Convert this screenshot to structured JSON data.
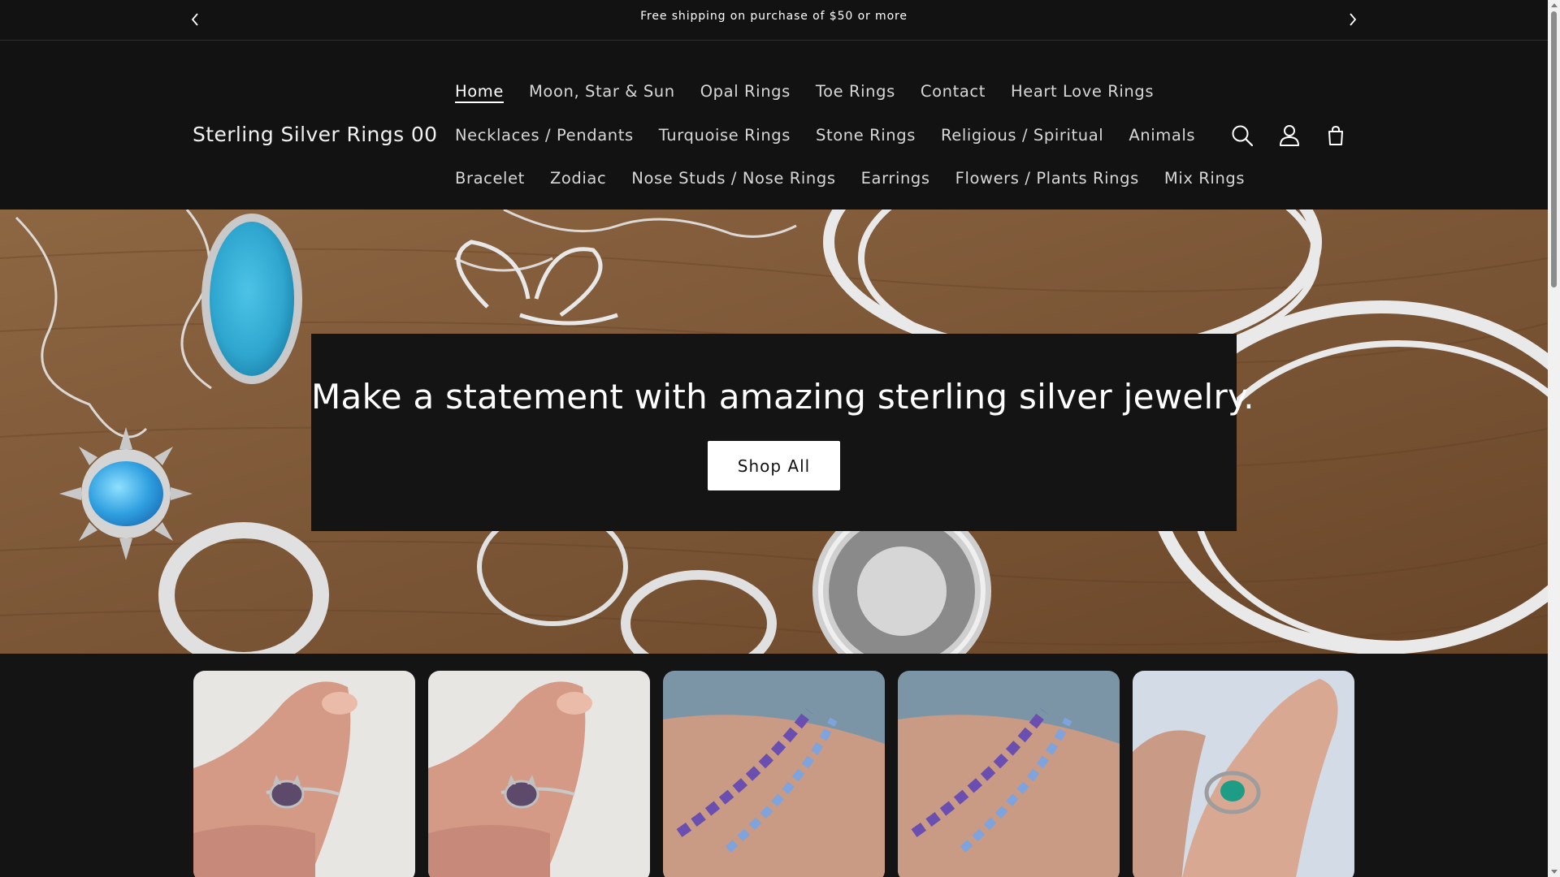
{
  "announcement": {
    "text": "Free shipping on purchase of $50 or more",
    "prev_icon": "chevron-left-icon",
    "next_icon": "chevron-right-icon"
  },
  "header": {
    "logo": "Sterling Silver Rings 00",
    "nav_rows": [
      [
        "Home",
        "Moon, Star & Sun",
        "Opal Rings",
        "Toe Rings",
        "Contact",
        "Heart Love Rings"
      ],
      [
        "Necklaces / Pendants",
        "Turquoise Rings",
        "Stone Rings",
        "Religious / Spiritual",
        "Animals"
      ],
      [
        "Bracelet",
        "Zodiac",
        "Nose Studs / Nose Rings",
        "Earrings",
        "Flowers / Plants Rings",
        "Mix Rings"
      ]
    ],
    "active_item": "Home",
    "icons": [
      "search-icon",
      "account-icon",
      "cart-icon"
    ]
  },
  "hero": {
    "heading": "Make a statement with amazing sterling silver jewelry.",
    "button_label": "Shop All"
  },
  "products": [
    {
      "image": "cat amethyst ring on thumb"
    },
    {
      "image": "cat amethyst ring on thumb"
    },
    {
      "image": "amethyst and blue topaz bracelets on wrist"
    },
    {
      "image": "amethyst and blue topaz bracelets on wrist"
    },
    {
      "image": "turquoise ring on finger"
    }
  ],
  "colors": {
    "background": "#141414",
    "header_bg": "#121212",
    "text": "#ffffff",
    "nav_text": "#d7d7d7",
    "button_bg": "#ffffff",
    "button_text": "#121212"
  }
}
